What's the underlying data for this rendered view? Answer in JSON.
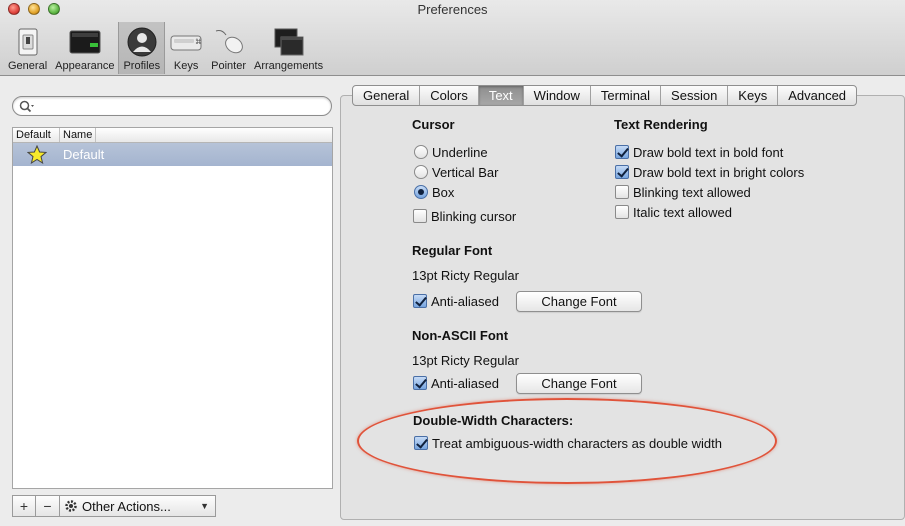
{
  "window": {
    "title": "Preferences"
  },
  "toolbar": {
    "items": [
      {
        "label": "General",
        "icon": "switch-icon"
      },
      {
        "label": "Appearance",
        "icon": "monitor-icon"
      },
      {
        "label": "Profiles",
        "icon": "user-icon",
        "selected": true
      },
      {
        "label": "Keys",
        "icon": "keyboard-icon"
      },
      {
        "label": "Pointer",
        "icon": "mouse-icon"
      },
      {
        "label": "Arrangements",
        "icon": "windows-icon"
      }
    ]
  },
  "search": {
    "placeholder": "",
    "value": ""
  },
  "profiles_table": {
    "columns": [
      "Default",
      "Name"
    ],
    "rows": [
      {
        "default": true,
        "name": "Default"
      }
    ]
  },
  "bottom_bar": {
    "add": "+",
    "remove": "−",
    "other_actions": "Other Actions..."
  },
  "tabs": [
    "General",
    "Colors",
    "Text",
    "Window",
    "Terminal",
    "Session",
    "Keys",
    "Advanced"
  ],
  "selected_tab": "Text",
  "cursor": {
    "title": "Cursor",
    "options": [
      "Underline",
      "Vertical Bar",
      "Box"
    ],
    "selected": "Box",
    "blinking_label": "Blinking cursor",
    "blinking": false
  },
  "text_rendering": {
    "title": "Text Rendering",
    "options": [
      {
        "label": "Draw bold text in bold font",
        "checked": true
      },
      {
        "label": "Draw bold text in bright colors",
        "checked": true
      },
      {
        "label": "Blinking text allowed",
        "checked": false
      },
      {
        "label": "Italic text allowed",
        "checked": false
      }
    ]
  },
  "regular_font": {
    "title": "Regular Font",
    "font": "13pt Ricty Regular",
    "anti_aliased_label": "Anti-aliased",
    "anti_aliased": true,
    "change_button": "Change Font"
  },
  "non_ascii_font": {
    "title": "Non-ASCII Font",
    "font": "13pt Ricty Regular",
    "anti_aliased_label": "Anti-aliased",
    "anti_aliased": true,
    "change_button": "Change Font"
  },
  "double_width": {
    "title": "Double-Width Characters:",
    "option_label": "Treat ambiguous-width characters as double width",
    "checked": true
  },
  "colors": {
    "highlight": "#e0533a",
    "selection": "#a4b4cf"
  }
}
